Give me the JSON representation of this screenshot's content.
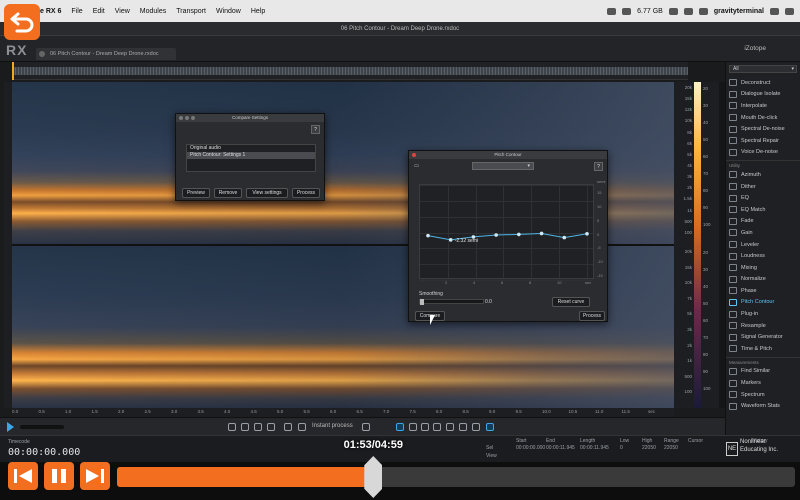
{
  "menubar": {
    "app_name": "e RX 6",
    "items": [
      "File",
      "Edit",
      "View",
      "Modules",
      "Transport",
      "Window",
      "Help"
    ],
    "disk": "6.77 GB",
    "user": "gravityterminal"
  },
  "window": {
    "title": "06 Pitch Contour - Dream Deep Drone.rxdoc",
    "tab": "06 Pitch Contour - Dream Deep Drone.rxdoc",
    "logo": "RX",
    "brand": "iZotope"
  },
  "modules": {
    "filter": "All",
    "repair": [
      "Deconstruct",
      "Dialogue Isolate",
      "Interpolate",
      "Mouth De-click",
      "Spectral De-noise",
      "Spectral Repair",
      "Voice De-noise"
    ],
    "utility_group": "Utility",
    "utility": [
      "Azimuth",
      "Dither",
      "EQ",
      "EQ Match",
      "Fade",
      "Gain",
      "Leveler",
      "Loudness",
      "Mixing",
      "Normalize",
      "Phase",
      "Pitch Contour",
      "Plug-in",
      "Resample",
      "Signal Generator",
      "Time & Pitch"
    ],
    "measurement_group": "Measurements",
    "measurements": [
      "Find Similar",
      "Markers",
      "Spectrum",
      "Waveform Stats"
    ],
    "active": "Pitch Contour"
  },
  "freq_scale": [
    "20k",
    "15k",
    "12k",
    "10k",
    "8k",
    "6k",
    "5k",
    "4k",
    "3k",
    "2k",
    "1.5k",
    "1k",
    "500",
    "100",
    "20k",
    "15k",
    "10k",
    "7k",
    "5k",
    "3k",
    "2k",
    "1k",
    "500",
    "100"
  ],
  "db_scale": [
    "20",
    "30",
    "40",
    "50",
    "60",
    "70",
    "80",
    "90",
    "100",
    "20",
    "30",
    "40",
    "50",
    "60",
    "70",
    "80",
    "90",
    "100"
  ],
  "time_ruler": [
    "0.0",
    "0.5",
    "1.0",
    "1.5",
    "2.0",
    "2.5",
    "3.0",
    "3.5",
    "4.0",
    "4.5",
    "5.0",
    "5.5",
    "6.0",
    "6.5",
    "7.0",
    "7.5",
    "8.0",
    "8.5",
    "9.0",
    "9.5",
    "10.0",
    "10.5",
    "11.0",
    "11.5",
    "sec"
  ],
  "toolbar": {
    "instant_process": "Instant process"
  },
  "status": {
    "timecode": "00:00:00.000",
    "timecode_label": "Timecode",
    "start_label": "Start",
    "end_label": "End",
    "length_label": "Length",
    "low_label": "Low",
    "high_label": "High",
    "range_label": "Range",
    "cursor_label": "Cursor",
    "sel_label": "Sel",
    "view_label": "View",
    "start_sel": "00:00:00.000",
    "end_sel": "00:00:11.945",
    "length_sel": "00:00:11.945",
    "low_sel": "0",
    "high_sel": "22050",
    "range_sel": "22050",
    "history_label": "History"
  },
  "compare_dialog": {
    "title": "Compare Settings",
    "items": [
      "Original audio",
      "Pitch Contour: Settings 1"
    ],
    "buttons": [
      "Preview",
      "Remove",
      "View settings",
      "Process"
    ],
    "help": "?"
  },
  "pitch_dialog": {
    "title": "Pitch Contour",
    "help": "?",
    "preset": "",
    "y_axis_unit": "semi",
    "y_ticks": [
      "15",
      "10",
      "5",
      "0",
      "-5",
      "-10",
      "-15"
    ],
    "x_ticks": [
      "2",
      "4",
      "6",
      "8",
      "10",
      "sec"
    ],
    "point_label": "-2.32 semi",
    "smoothing_label": "Smoothing",
    "smoothing_value": "0.0",
    "reset_button": "Reset curve",
    "compare_button": "Compare",
    "process_button": "Process",
    "curve_semitones": [
      -1.0,
      -2.32,
      -1.4,
      -0.8,
      -0.6,
      -0.3,
      -1.6,
      -0.4
    ]
  },
  "player": {
    "time": "01:53/04:59",
    "progress": 0.378
  },
  "badge": {
    "line1": "Nonlinear",
    "line2": "Educating Inc.",
    "mark": "NE"
  }
}
